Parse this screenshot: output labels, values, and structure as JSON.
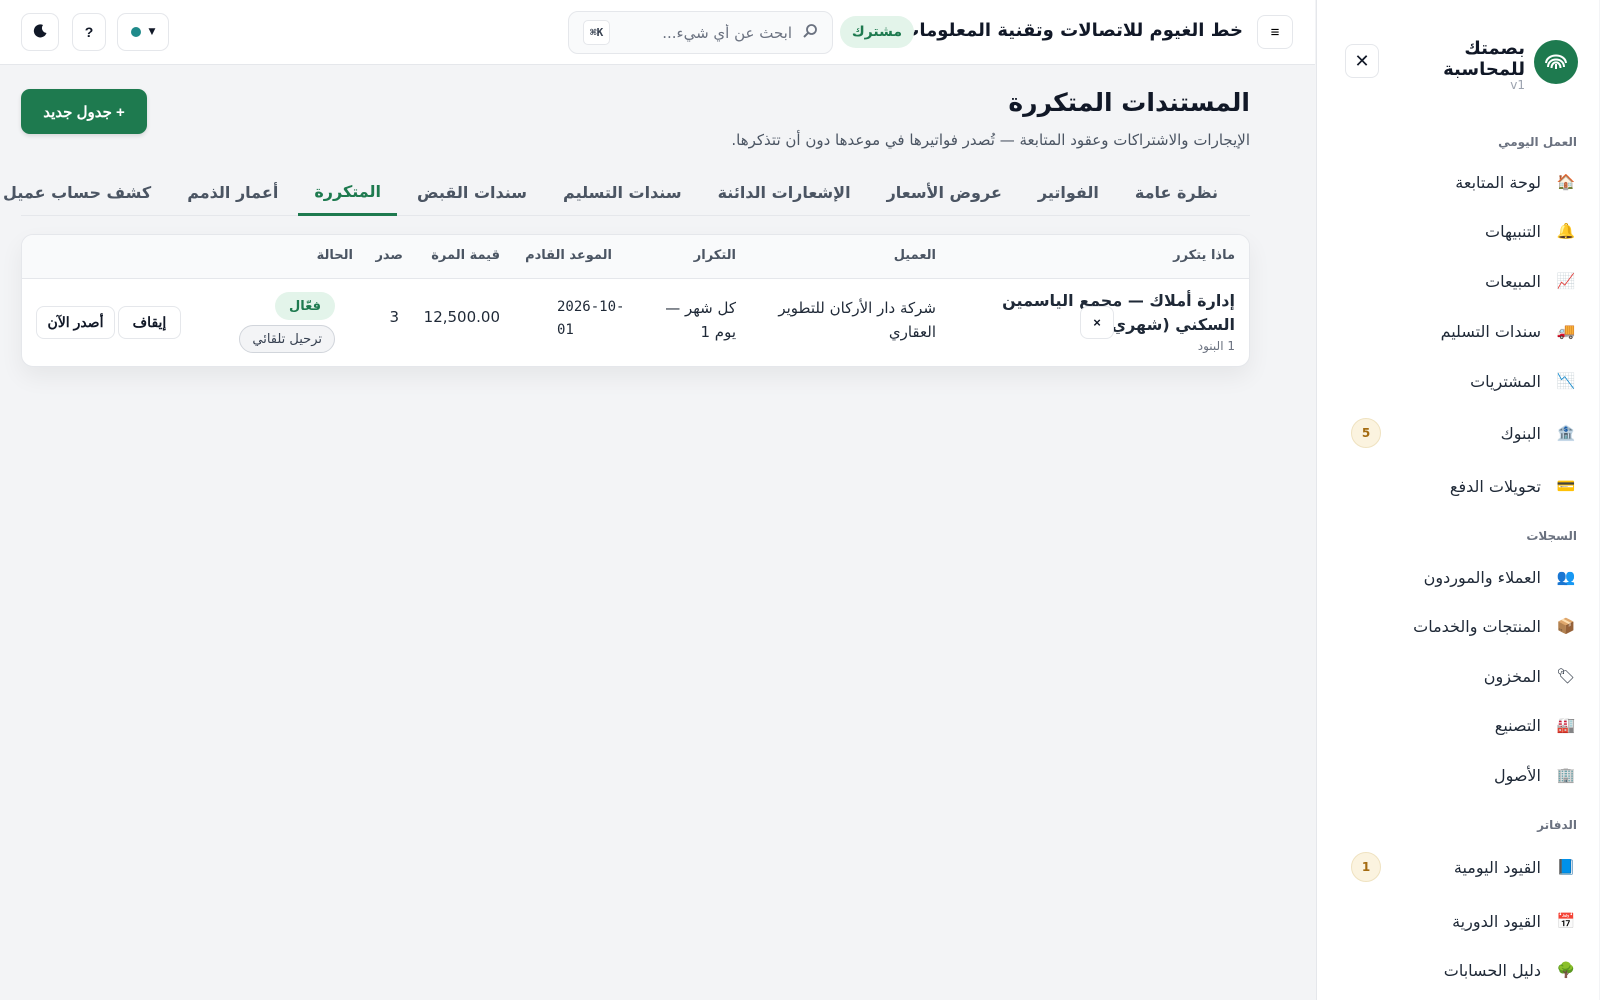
{
  "sidebar": {
    "brand": {
      "name_line1": "بصمتك",
      "name_line2": "للمحاسبة",
      "version": "v1"
    },
    "close_label": "✕",
    "sections": [
      {
        "title": "العمل اليومي",
        "items": [
          {
            "label": "لوحة المتابعة",
            "icon": "🏠"
          },
          {
            "label": "التنبيهات",
            "icon": "🔔"
          },
          {
            "label": "المبيعات",
            "icon": "📈"
          },
          {
            "label": "سندات التسليم",
            "icon": "🚚"
          },
          {
            "label": "المشتريات",
            "icon": "📉"
          },
          {
            "label": "البنوك",
            "icon": "🏦",
            "badge": "5"
          },
          {
            "label": "تحويلات الدفع",
            "icon": "💳"
          }
        ]
      },
      {
        "title": "السجلات",
        "items": [
          {
            "label": "العملاء والموردون",
            "icon": "👥"
          },
          {
            "label": "المنتجات والخدمات",
            "icon": "📦"
          },
          {
            "label": "المخزون",
            "icon": "🏷"
          },
          {
            "label": "التصنيع",
            "icon": "🏭"
          },
          {
            "label": "الأصول",
            "icon": "🏢"
          }
        ]
      },
      {
        "title": "الدفاتر",
        "items": [
          {
            "label": "القيود اليومية",
            "icon": "📘",
            "badge": "1"
          },
          {
            "label": "القيود الدورية",
            "icon": "📅"
          },
          {
            "label": "دليل الحسابات",
            "icon": "🌳"
          }
        ]
      }
    ]
  },
  "topbar": {
    "menu_label": "≡",
    "company": "خط الغيوم للاتصالات وتقنية المعلومات",
    "plan_badge": "مشترك",
    "search": {
      "placeholder": "ابحث عن أي شيء...",
      "shortcut": "K⌘"
    },
    "help_label": "?",
    "theme_icon": "moon-icon",
    "status_dot_color": "#1f8a8a"
  },
  "page": {
    "title": "المستندات المتكررة",
    "subtitle": "الإيجارات والاشتراكات وعقود المتابعة — تُصدر فواتيرها في موعدها دون أن تتذكرها.",
    "new_button": "+ جدول جديد"
  },
  "tabs": [
    {
      "label": "نظرة عامة",
      "active": false
    },
    {
      "label": "الفواتير",
      "active": false
    },
    {
      "label": "عروض الأسعار",
      "active": false
    },
    {
      "label": "الإشعارات الدائنة",
      "active": false
    },
    {
      "label": "سندات التسليم",
      "active": false
    },
    {
      "label": "سندات القبض",
      "active": false
    },
    {
      "label": "المتكررة",
      "active": true
    },
    {
      "label": "أعمار الذمم",
      "active": false
    },
    {
      "label": "كشف حساب عميل",
      "active": false
    }
  ],
  "table": {
    "headers": {
      "what": "ماذا يتكرر",
      "customer": "العميل",
      "frequency": "التكرار",
      "next_date": "الموعد القادم",
      "amount": "قيمة المرة",
      "issued": "صدر",
      "status": "الحالة"
    },
    "rows": [
      {
        "what_line1": "إدارة أملاك — مجمع الياسمين",
        "what_line2": "السكني (شهري)",
        "items_count": "1 البنود",
        "customer_line1": "شركة دار الأركان للتطوير",
        "customer_line2": "العقاري",
        "frequency_line1": "كل شهر —",
        "frequency_line2": "يوم 1",
        "next_line1": "2026-10-",
        "next_line2": "01",
        "amount": "12,500.00",
        "issued": "3",
        "status": "فعّال",
        "auto_post": "ترحيل تلقائي",
        "actions": {
          "issue_now": "أصدر الآن",
          "pause": "إيقاف",
          "delete": "×"
        }
      }
    ]
  },
  "colors": {
    "accent": "#1e7a4f",
    "accent_soft": "#e3f4ea",
    "badge_bg": "#fbf3df",
    "badge_text": "#a46b10"
  }
}
